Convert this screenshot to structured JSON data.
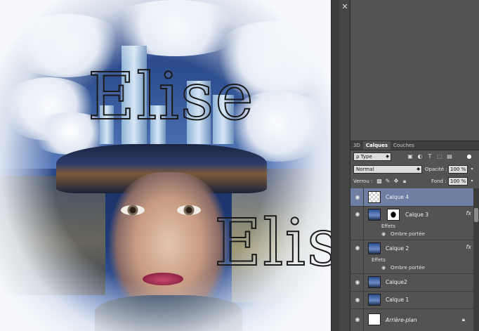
{
  "canvas": {
    "watermark_text_1": "Elise",
    "watermark_text_2": "Elise"
  },
  "panel": {
    "collapse_icon": "collapse-arrows-icon",
    "tabs": [
      {
        "label": "3D",
        "active": false
      },
      {
        "label": "Calques",
        "active": true
      },
      {
        "label": "Couches",
        "active": false
      }
    ],
    "filter": {
      "value": "ρ Type"
    },
    "blend_mode": "Normal",
    "opacity_label": "Opacité :",
    "opacity_value": "100 %",
    "lock_label": "Verrou :",
    "fill_label": "Fond :",
    "fill_value": "100 %",
    "colors": {
      "panel_bg": "#535353",
      "selected_row": "#6f7fa3"
    }
  },
  "layers": [
    {
      "name": "Calque 4",
      "selected": true,
      "thumb": "checker"
    },
    {
      "name": "Calque 3",
      "selected": false,
      "thumb": "photo",
      "fx": "fx",
      "effects_label": "Effets",
      "effect": "Ombre portée"
    },
    {
      "name": "Calque 2",
      "selected": false,
      "thumb": "photo",
      "fx": "fx",
      "effects_label": "Effets",
      "effect": "Ombre portée"
    },
    {
      "name": "Calque2",
      "selected": false,
      "thumb": "photo"
    },
    {
      "name": "Calque 1",
      "selected": false,
      "thumb": "photo"
    },
    {
      "name": "Arrière-plan",
      "selected": false,
      "thumb": "white",
      "locked": true
    }
  ]
}
